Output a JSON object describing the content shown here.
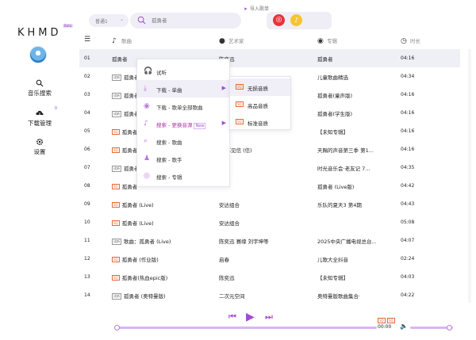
{
  "app": {
    "logo": "KHMD",
    "logo_badge": "Beta"
  },
  "sidebar": {
    "items": [
      {
        "label": "音乐搜索",
        "icon": "search-music-icon"
      },
      {
        "label": "下载管理",
        "icon": "cloud-download-icon",
        "badge": "0"
      },
      {
        "label": "设置",
        "icon": "gear-icon"
      }
    ]
  },
  "topbar": {
    "source_value": "普通1",
    "search_placeholder": "孤勇者",
    "import_label": "导入歌单",
    "import_sources": [
      "netease-music-icon",
      "qq-music-icon"
    ]
  },
  "table": {
    "headers": {
      "title": "歌曲",
      "artist": "艺术家",
      "album": "专辑",
      "duration": "时长"
    },
    "rows": [
      {
        "num": "01",
        "tag": "",
        "title": "孤勇者",
        "artist": "陈奕迅",
        "album": "孤勇者",
        "duration": "04:16"
      },
      {
        "num": "02",
        "tag": "试听",
        "title": "孤勇者",
        "artist": "",
        "album": "儿童歌曲精选",
        "duration": "04:34"
      },
      {
        "num": "03",
        "tag": "试听",
        "title": "孤勇者",
        "artist": "",
        "album": "孤勇者(童声版)",
        "duration": "04:16"
      },
      {
        "num": "04",
        "tag": "试听",
        "title": "孤勇者",
        "artist": "",
        "album": "孤勇者(学生版)",
        "duration": "04:16"
      },
      {
        "num": "05",
        "tag": "SQ",
        "title": "孤勇者",
        "artist": "",
        "album": "【未知专辑】",
        "duration": "04:16"
      },
      {
        "num": "06",
        "tag": "SQ",
        "title": "孤勇者",
        "artist": "品 苏见信 (信)",
        "album": "天赐的声音第三季 第1...",
        "duration": "04:16"
      },
      {
        "num": "07",
        "tag": "试听",
        "title": "孤勇者",
        "artist": "",
        "album": "时光音乐会·老友记 7...",
        "duration": "04:35"
      },
      {
        "num": "08",
        "tag": "SQ",
        "title": "孤勇者",
        "artist": "",
        "album": "孤勇者 (Live版)",
        "duration": "04:42"
      },
      {
        "num": "09",
        "tag": "SQ",
        "title": "孤勇者 (Live)",
        "artist": "安达组合",
        "album": "乐队的夏天3 第4期",
        "duration": "04:43"
      },
      {
        "num": "10",
        "tag": "SQ",
        "title": "孤勇者 (Live)",
        "artist": "安达组合",
        "album": "",
        "duration": "05:08"
      },
      {
        "num": "11",
        "tag": "试听",
        "title": "歌曲：孤勇者 (Live)",
        "artist": "陈奕迅 赛缘 刘宇坤等",
        "album": "2025中央广播电视总台...",
        "duration": "04:07"
      },
      {
        "num": "12",
        "tag": "SQ",
        "title": "孤勇者 (作业版)",
        "artist": "启春",
        "album": "儿歌大全抖音",
        "duration": "02:24"
      },
      {
        "num": "13",
        "tag": "SQ",
        "title": "孤勇者(热血epic版)",
        "artist": "陈奕迅",
        "album": "【未知专辑】",
        "duration": "04:03"
      },
      {
        "num": "14",
        "tag": "试听",
        "title": "孤勇者 (奥特曼版)",
        "artist": "二次元空间",
        "album": "奥特曼版歌曲集合·",
        "duration": "04:22"
      }
    ]
  },
  "context_menu": {
    "items": [
      {
        "label": "试听",
        "icon": "headphones-icon"
      },
      {
        "label": "下载 - 单曲",
        "icon": "download-icon",
        "arrow": "▶"
      },
      {
        "label": "下载 - 歌单全部歌曲",
        "icon": "disc-icon"
      },
      {
        "label": "搜索 - 更换音源",
        "icon": "music-note-icon",
        "new": "New",
        "arrow": "▶"
      },
      {
        "label": "搜索 - 歌曲",
        "icon": "search-song-icon"
      },
      {
        "label": "搜索 - 歌手",
        "icon": "singer-icon"
      },
      {
        "label": "搜索 - 专辑",
        "icon": "album-icon"
      }
    ],
    "submenu": [
      {
        "tag": "SQ",
        "label": "无损音质"
      },
      {
        "tag": "SQ",
        "label": "高品音质"
      },
      {
        "tag": "SQ",
        "label": "标准音质"
      }
    ]
  },
  "player": {
    "time": "00:00",
    "quality_tags": [
      "SQ",
      "SQ"
    ],
    "progress": 0,
    "volume": 0.9
  },
  "colors": {
    "accent": "#a24bd6",
    "light_accent": "#d9b6ef",
    "sq_tag": "#e86a3a"
  }
}
